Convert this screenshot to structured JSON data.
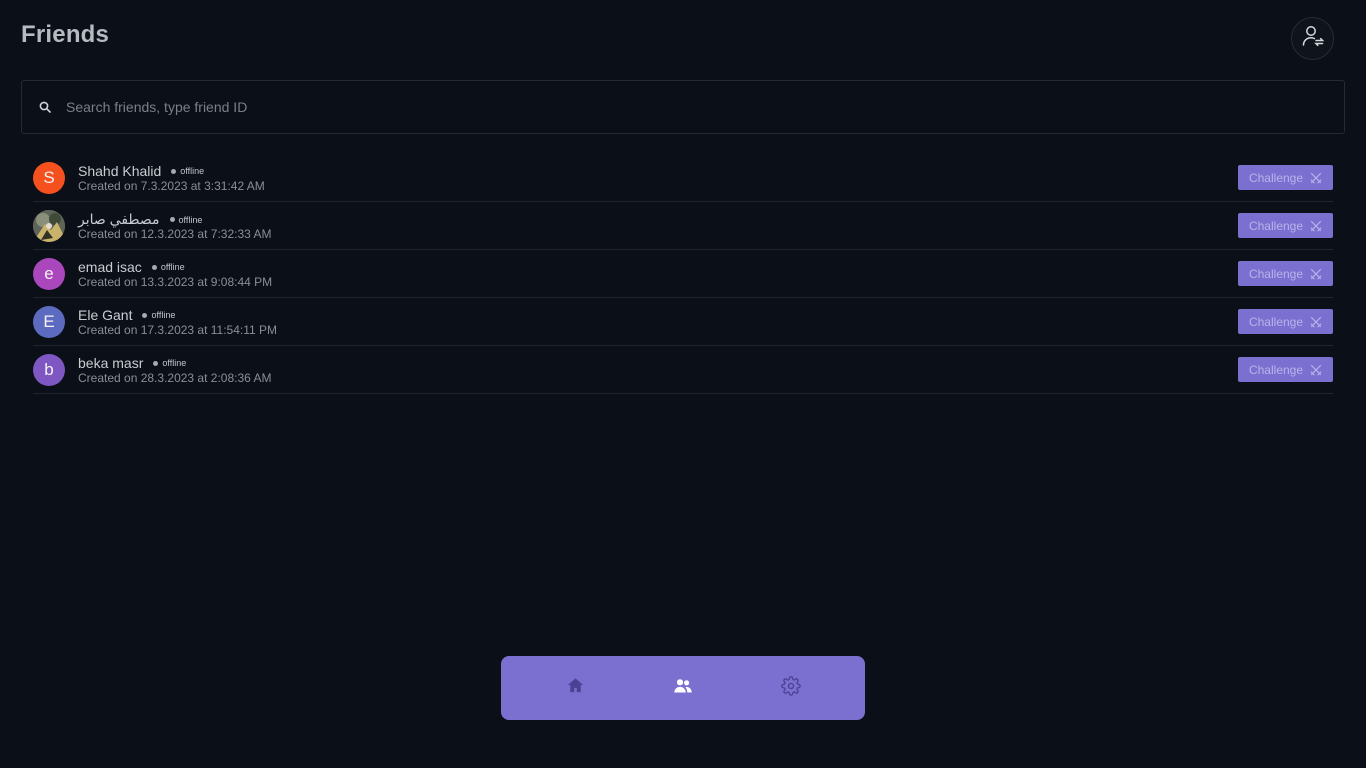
{
  "header": {
    "title": "Friends",
    "profile_icon": "user-switch-icon"
  },
  "search": {
    "placeholder": "Search friends, type friend ID",
    "value": "",
    "icon": "search-icon"
  },
  "friends": [
    {
      "initial": "S",
      "name": "Shahd Khalid",
      "status": "offline",
      "created": "Created on 7.3.2023 at 3:31:42 AM",
      "avatar_color": "#f4511e",
      "challenge_label": "Challenge"
    },
    {
      "initial": "",
      "name": "مصطفي صابر",
      "status": "offline",
      "created": "Created on 12.3.2023 at 7:32:33 AM",
      "avatar_color": "#6b6a55",
      "challenge_label": "Challenge"
    },
    {
      "initial": "e",
      "name": "emad isac",
      "status": "offline",
      "created": "Created on 13.3.2023 at 9:08:44 PM",
      "avatar_color": "#ab47bc",
      "challenge_label": "Challenge"
    },
    {
      "initial": "E",
      "name": "Ele Gant",
      "status": "offline",
      "created": "Created on 17.3.2023 at 11:54:11 PM",
      "avatar_color": "#5c6bc0",
      "challenge_label": "Challenge"
    },
    {
      "initial": "b",
      "name": "beka masr",
      "status": "offline",
      "created": "Created on 28.3.2023 at 2:08:36 AM",
      "avatar_color": "#7e57c2",
      "challenge_label": "Challenge"
    }
  ],
  "nav": {
    "items": [
      {
        "icon": "home-icon",
        "active": false
      },
      {
        "icon": "friends-icon",
        "active": true
      },
      {
        "icon": "settings-icon",
        "active": false
      }
    ]
  },
  "colors": {
    "background": "#0b0f17",
    "accent": "#7b6fd0"
  }
}
